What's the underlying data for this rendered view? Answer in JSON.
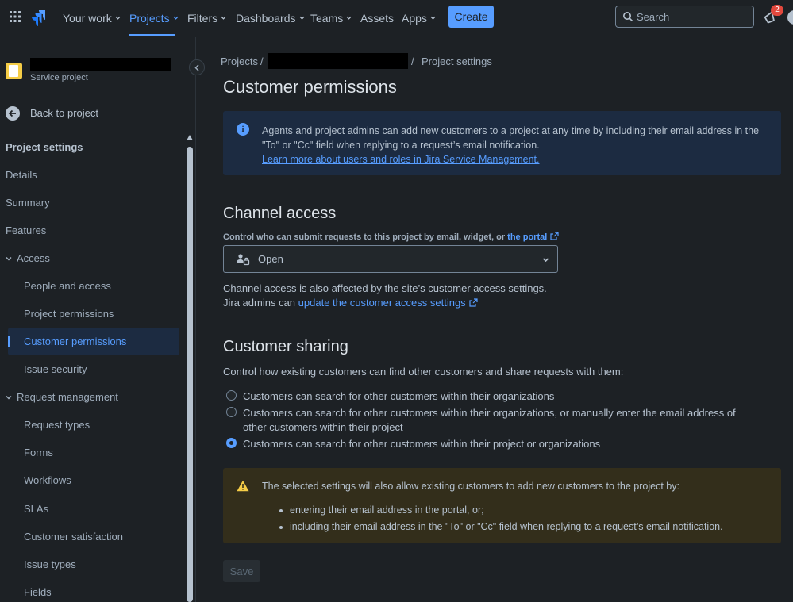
{
  "topnav": {
    "items": [
      {
        "label": "Your work"
      },
      {
        "label": "Projects"
      },
      {
        "label": "Filters"
      },
      {
        "label": "Dashboards"
      },
      {
        "label": "Teams"
      },
      {
        "label": "Assets"
      },
      {
        "label": "Apps"
      }
    ],
    "create_label": "Create",
    "search_placeholder": "Search",
    "notification_count": "2",
    "accent_color": "#579dff"
  },
  "sidebar": {
    "project_type": "Service project",
    "back_label": "Back to project",
    "heading": "Project settings",
    "items": [
      {
        "label": "Details"
      },
      {
        "label": "Summary"
      },
      {
        "label": "Features"
      },
      {
        "label": "Access"
      },
      {
        "label": "People and access"
      },
      {
        "label": "Project permissions"
      },
      {
        "label": "Customer permissions"
      },
      {
        "label": "Issue security"
      },
      {
        "label": "Request management"
      },
      {
        "label": "Request types"
      },
      {
        "label": "Forms"
      },
      {
        "label": "Workflows"
      },
      {
        "label": "SLAs"
      },
      {
        "label": "Customer satisfaction"
      },
      {
        "label": "Issue types"
      },
      {
        "label": "Fields"
      }
    ]
  },
  "breadcrumb": {
    "first": "Projects",
    "separator": "/",
    "last": "Project settings"
  },
  "page": {
    "title": "Customer permissions",
    "info": {
      "text": "Agents and project admins can add new customers to a project at any time by including their email address in the \"To\" or \"Cc\" field when replying to a request’s email notification.",
      "link": "Learn more about users and roles in Jira Service Management."
    },
    "channel": {
      "heading": "Channel access",
      "help": "Control who can submit requests to this project by email, widget, or",
      "help_link": "the portal",
      "select_value": "Open",
      "note1": "Channel access is also affected by the site’s customer access settings.",
      "note2_prefix": "Jira admins can",
      "note2_link": "update the customer access settings"
    },
    "sharing": {
      "heading": "Customer sharing",
      "description": "Control how existing customers can find other customers and share requests with them:",
      "options": [
        {
          "label": "Customers can search for other customers within their organizations"
        },
        {
          "label": "Customers can search for other customers within their organizations, or manually enter the email address of other customers within their project"
        },
        {
          "label": "Customers can search for other customers within their project or organizations"
        }
      ],
      "selected_option": "Customers can search for other customers within their project or organizations"
    },
    "warning": {
      "text": "The selected settings will also allow existing customers to add new customers to the project by:",
      "bullets": [
        "entering their email address in the portal, or;",
        "including their email address in the \"To\" or \"Cc\" field when replying to a request’s email notification."
      ]
    },
    "save_label": "Save"
  }
}
